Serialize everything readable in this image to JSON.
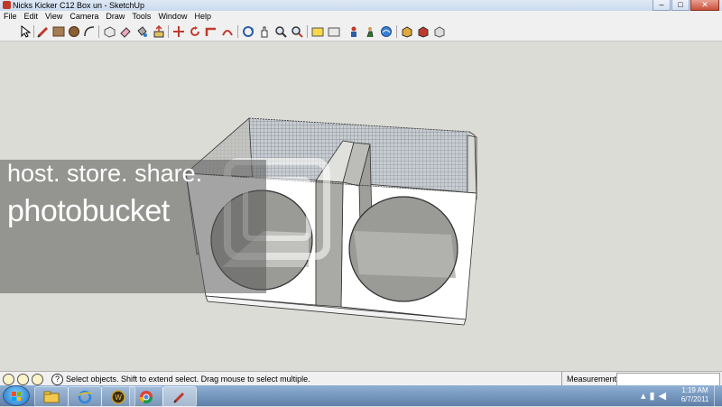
{
  "window": {
    "title": "Nicks Kicker C12 Box un - SketchUp",
    "minimize": "–",
    "maximize": "□",
    "close": "✕"
  },
  "menu": [
    "File",
    "Edit",
    "View",
    "Camera",
    "Draw",
    "Tools",
    "Window",
    "Help"
  ],
  "toolbar_icons": [
    "select-icon",
    "pencil-line-icon",
    "rectangle-icon",
    "circle-icon",
    "arc-icon",
    "make-component-icon",
    "eraser-icon",
    "paint-bucket-icon",
    "push-pull-icon",
    "move-icon",
    "rotate-icon",
    "follow-me-icon",
    "orbit-icon",
    "pan-icon",
    "zoom-icon",
    "zoom-extents-icon",
    "previous-view-icon",
    "next-view-icon",
    "place-camera-icon",
    "walk-icon",
    "look-around-icon",
    "get-models-icon",
    "share-model-icon",
    "components-icon",
    "materials-icon"
  ],
  "watermark": {
    "line1": "host. store. share.",
    "line2": "photobucket"
  },
  "status": {
    "message": "Select objects. Shift to extend select. Drag mouse to select multiple.",
    "measurements_label": "Measurements",
    "measurements_value": ""
  },
  "taskbar": {
    "time": "1:19 AM",
    "date": "6/7/2011"
  },
  "colors": {
    "viewport": "#dcdcd6",
    "taskbar": "#6f8fb8",
    "close_button": "#c9503a"
  }
}
